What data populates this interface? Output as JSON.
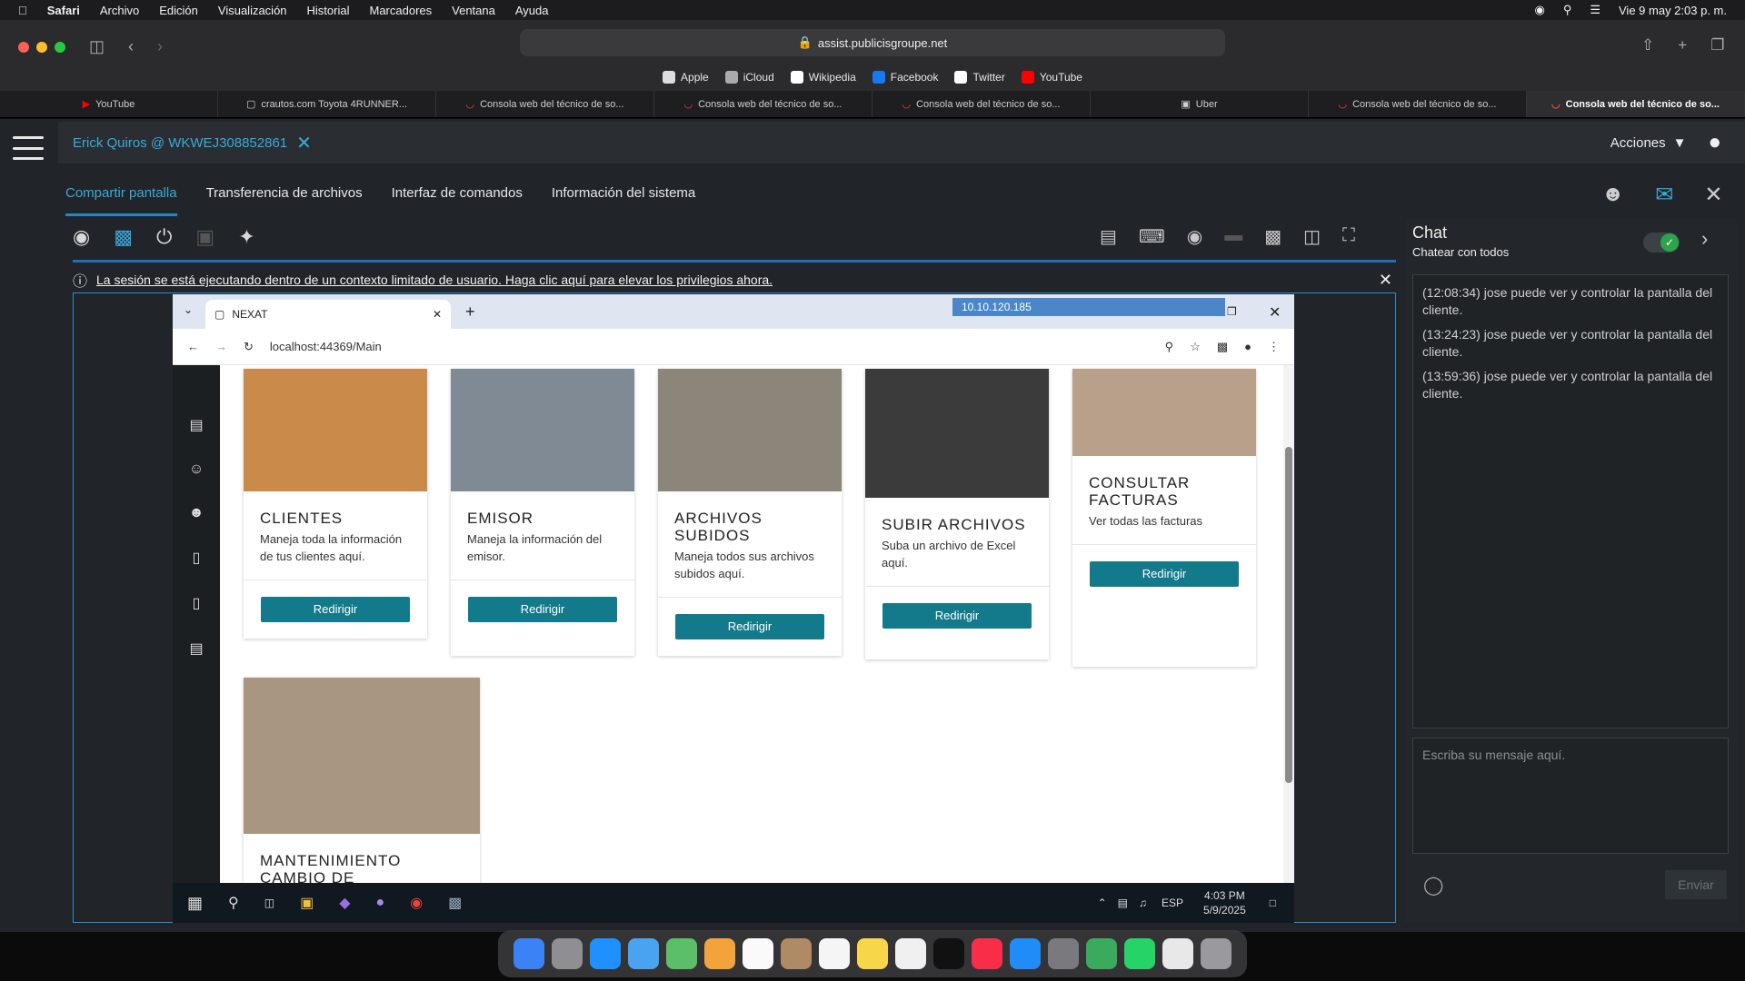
{
  "menubar": {
    "app": "Safari",
    "items": [
      "Archivo",
      "Edición",
      "Visualización",
      "Historial",
      "Marcadores",
      "Ventana",
      "Ayuda"
    ],
    "datetime": "Vie 9 may  2:03 p. m."
  },
  "safari": {
    "url": "assist.publicisgroupe.net",
    "favorites": [
      {
        "label": "Apple",
        "color": "#dddddd"
      },
      {
        "label": "iCloud",
        "color": "#aaaaaa"
      },
      {
        "label": "Wikipedia",
        "color": "#ffffff"
      },
      {
        "label": "Facebook",
        "color": "#1877f2"
      },
      {
        "label": "Twitter",
        "color": "#ffffff"
      },
      {
        "label": "YouTube",
        "color": "#ff0000"
      }
    ],
    "tabs": [
      {
        "label": "YouTube"
      },
      {
        "label": "crautos.com Toyota 4RUNNER..."
      },
      {
        "label": "Consola web del técnico de so..."
      },
      {
        "label": "Consola web del técnico de so..."
      },
      {
        "label": "Consola web del técnico de so..."
      },
      {
        "label": "Uber"
      },
      {
        "label": "Consola web del técnico de so..."
      },
      {
        "label": "Consola web del técnico de so..."
      }
    ]
  },
  "session": {
    "title": "Erick Quiros @ WKWEJ308852861",
    "actions": "Acciones"
  },
  "nav": {
    "tabs": [
      "Compartir pantalla",
      "Transferencia de archivos",
      "Interfaz de comandos",
      "Información del sistema"
    ]
  },
  "notice": "La sesión se está ejecutando dentro de un contexto limitado de usuario. Haga clic aquí para elevar los privilegios ahora.",
  "remote": {
    "tab_title": "NEXAT",
    "ip": "10.10.120.185",
    "address": "localhost:44369/Main",
    "clock_time": "4:03 PM",
    "clock_date": "5/9/2025",
    "lang": "ESP",
    "cards": [
      {
        "title": "CLIENTES",
        "desc": "Maneja toda la información de tus clientes aquí.",
        "button": "Redirigir",
        "color": "#c98a4a"
      },
      {
        "title": "EMISOR",
        "desc": "Maneja la información del emisor.",
        "button": "Redirigir",
        "color": "#7f8a94"
      },
      {
        "title": "ARCHIVOS SUBIDOS",
        "desc": "Maneja todos sus archivos subidos aquí.",
        "button": "Redirigir",
        "color": "#8c857a"
      },
      {
        "title": "SUBIR ARCHIVOS",
        "desc": "Suba un archivo de Excel aquí.",
        "button": "Redirigir",
        "color": "#3b3b3b"
      },
      {
        "title": "CONSULTAR FACTURAS",
        "desc": "Ver todas las facturas",
        "button": "Redirigir",
        "color": "#b8a08a"
      },
      {
        "title": "MANTENIMIENTO CAMBIO DE ESTADO",
        "desc": "",
        "button": "",
        "color": "#a99680"
      }
    ]
  },
  "chat": {
    "title": "Chat",
    "subtitle": "Chatear con todos",
    "messages": [
      "(12:08:34) jose puede ver y controlar la pantalla del cliente.",
      "(13:24:23) jose puede ver y controlar la pantalla del cliente.",
      "(13:59:36) jose puede ver y controlar la pantalla del cliente."
    ],
    "placeholder": "Escriba su mensaje aquí.",
    "send": "Enviar"
  }
}
